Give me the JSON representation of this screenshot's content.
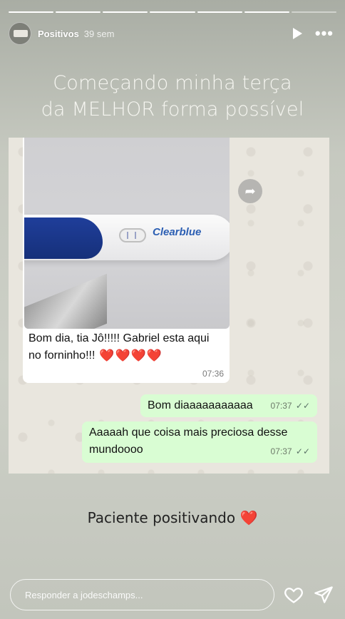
{
  "progress": {
    "segments": 7,
    "active_index": 6
  },
  "header": {
    "username": "Positivos",
    "time_ago": "39 sem",
    "icons": {
      "play": "play-icon",
      "more": "more-options-icon"
    }
  },
  "caption": {
    "line1": "Começando minha terça",
    "line2": "da MELHOR forma possível"
  },
  "chat": {
    "incoming": {
      "brand": "Clearblue",
      "text": "Bom dia, tia Jô!!!!! Gabriel esta aqui no forninho!!!",
      "hearts": "❤️❤️❤️❤️",
      "time": "07:36"
    },
    "outgoing": [
      {
        "text": "Bom diaaaaaaaaaaa",
        "time": "07:37"
      },
      {
        "text": "Aaaaah que coisa mais preciosa desse mundoooo",
        "time": "07:37"
      }
    ]
  },
  "bottom_caption": {
    "text": "Paciente positivando",
    "emoji": "❤️"
  },
  "reply": {
    "placeholder": "Responder a jodeschamps..."
  },
  "colors": {
    "outgoing_bubble": "#d9fdd3",
    "brand_blue": "#1f3e9a",
    "heart": "#e0242b"
  }
}
